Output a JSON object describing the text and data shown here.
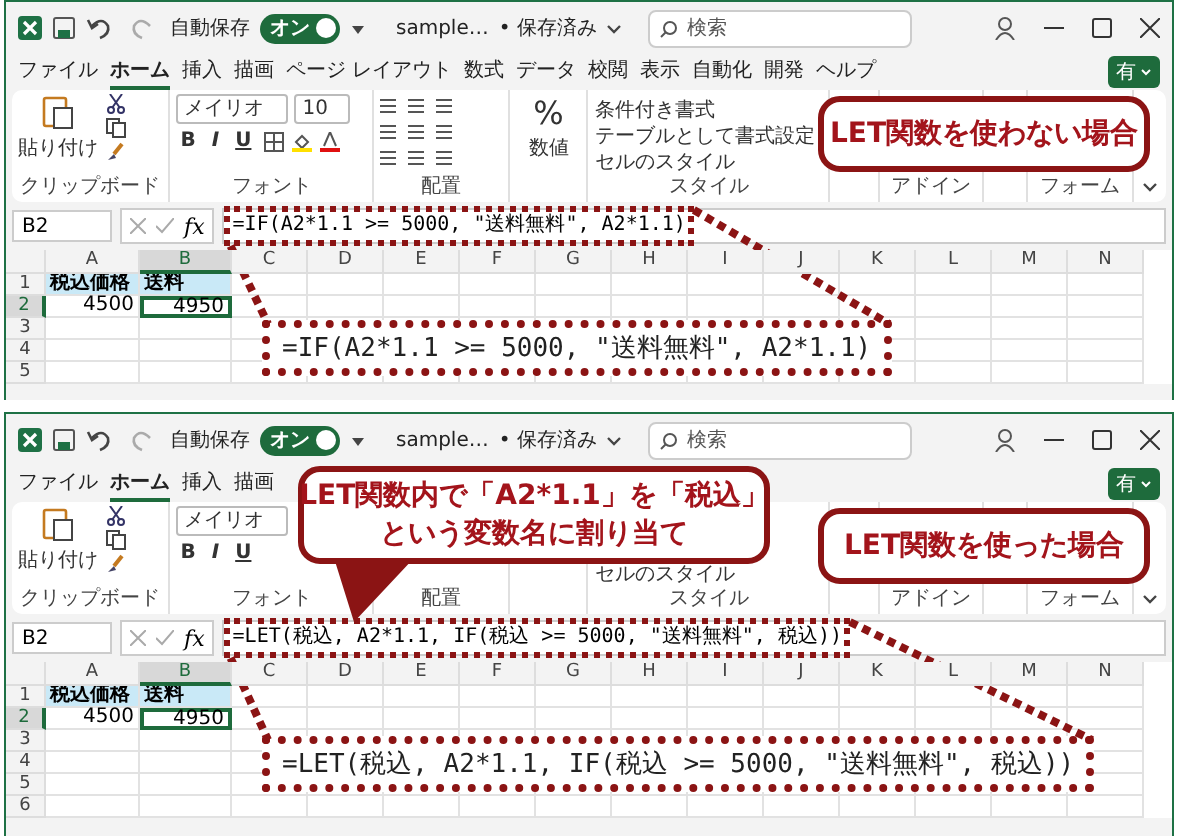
{
  "panels": [
    {
      "title_bar": {
        "autosave_label": "自動保存",
        "autosave_toggle": {
          "label": "オン",
          "on": true
        },
        "file_name": "sample…",
        "save_status": "• 保存済み",
        "search_placeholder": "検索"
      },
      "tabs": [
        {
          "label": "ファイル",
          "selected": false
        },
        {
          "label": "ホーム",
          "selected": true
        },
        {
          "label": "挿入",
          "selected": false
        },
        {
          "label": "描画",
          "selected": false
        },
        {
          "label": "ページ レイアウト",
          "selected": false
        },
        {
          "label": "数式",
          "selected": false
        },
        {
          "label": "データ",
          "selected": false
        },
        {
          "label": "校閲",
          "selected": false
        },
        {
          "label": "表示",
          "selected": false
        },
        {
          "label": "自動化",
          "selected": false
        },
        {
          "label": "開発",
          "selected": false
        },
        {
          "label": "ヘルプ",
          "selected": false
        }
      ],
      "share_button": "有",
      "ribbon": {
        "format_icons": true,
        "paste": "貼り付け",
        "clipboard": "クリップボード",
        "font_name": "メイリオ",
        "font_size": "10",
        "font_buttons": [
          "B",
          "I",
          "U"
        ],
        "font": "フォント",
        "alignment": "配置",
        "number_symbol": "%",
        "number_format": "数値",
        "style_items": [
          "条件付き書式",
          "テーブルとして書式設定",
          "セルのスタイル"
        ],
        "style": "スタイル",
        "addin": "アドイン",
        "form": "フォーム"
      },
      "formula_bar": {
        "name_box": "B2",
        "fx": "fx",
        "formula": "=IF(A2*1.1 >= 5000, \"送料無料\", A2*1.1)"
      },
      "columns": [
        {
          "label": "A",
          "selected": false
        },
        {
          "label": "B",
          "selected": true
        },
        {
          "label": "C",
          "selected": false
        },
        {
          "label": "D",
          "selected": false
        },
        {
          "label": "E",
          "selected": false
        },
        {
          "label": "F",
          "selected": false
        },
        {
          "label": "G",
          "selected": false
        },
        {
          "label": "H",
          "selected": false
        },
        {
          "label": "I",
          "selected": false
        },
        {
          "label": "J",
          "selected": false
        },
        {
          "label": "K",
          "selected": false
        },
        {
          "label": "L",
          "selected": false
        },
        {
          "label": "M",
          "selected": false
        },
        {
          "label": "N",
          "selected": false
        }
      ],
      "rows": [
        {
          "label": "1",
          "selected": false,
          "cells": [
            {
              "value": "税込価格",
              "kind": "header",
              "selected": false
            },
            {
              "value": "送料",
              "kind": "header",
              "selected": false
            }
          ]
        },
        {
          "label": "2",
          "selected": true,
          "cells": [
            {
              "value": "4500",
              "kind": "number",
              "selected": false
            },
            {
              "value": "4950",
              "kind": "number",
              "selected": true
            }
          ]
        },
        {
          "label": "3",
          "selected": false
        },
        {
          "label": "4",
          "selected": false
        },
        {
          "label": "5",
          "selected": false
        }
      ],
      "formula_zoom": "=IF(A2*1.1 >= 5000, \"送料無料\", A2*1.1)",
      "callouts": [
        {
          "lines": [
            "LET関数を使わない場合"
          ],
          "pointer": false
        }
      ]
    },
    {
      "title_bar": {
        "autosave_label": "自動保存",
        "autosave_toggle": {
          "label": "オン",
          "on": true
        },
        "file_name": "sample…",
        "save_status": "• 保存済み",
        "search_placeholder": "検索"
      },
      "tabs": [
        {
          "label": "ファイル",
          "selected": false
        },
        {
          "label": "ホーム",
          "selected": true
        },
        {
          "label": "挿入",
          "selected": false
        },
        {
          "label": "描画",
          "selected": false
        }
      ],
      "share_button": "有",
      "ribbon": {
        "paste": "貼り付け",
        "clipboard": "クリップボード",
        "font_name": "メイリオ",
        "font_buttons": [
          "B",
          "I",
          "U"
        ],
        "font": "フォント",
        "alignment": "配置",
        "style_items": [
          "セルのスタイル"
        ],
        "style": "スタイル",
        "addin": "アドイン",
        "form": "フォーム"
      },
      "formula_bar": {
        "name_box": "B2",
        "fx": "fx",
        "formula": "=LET(税込, A2*1.1, IF(税込 >= 5000, \"送料無料\", 税込))"
      },
      "columns": [
        {
          "label": "A",
          "selected": false
        },
        {
          "label": "B",
          "selected": true
        },
        {
          "label": "C",
          "selected": false
        },
        {
          "label": "D",
          "selected": false
        },
        {
          "label": "E",
          "selected": false
        },
        {
          "label": "F",
          "selected": false
        },
        {
          "label": "G",
          "selected": false
        },
        {
          "label": "H",
          "selected": false
        },
        {
          "label": "I",
          "selected": false
        },
        {
          "label": "J",
          "selected": false
        },
        {
          "label": "K",
          "selected": false
        },
        {
          "label": "L",
          "selected": false
        },
        {
          "label": "M",
          "selected": false
        },
        {
          "label": "N",
          "selected": false
        }
      ],
      "rows": [
        {
          "label": "1",
          "selected": false,
          "cells": [
            {
              "value": "税込価格",
              "kind": "header",
              "selected": false
            },
            {
              "value": "送料",
              "kind": "header",
              "selected": false
            }
          ]
        },
        {
          "label": "2",
          "selected": true,
          "cells": [
            {
              "value": "4500",
              "kind": "number",
              "selected": false
            },
            {
              "value": "4950",
              "kind": "number",
              "selected": true
            }
          ]
        },
        {
          "label": "3",
          "selected": false
        },
        {
          "label": "4",
          "selected": false
        },
        {
          "label": "5",
          "selected": false
        },
        {
          "label": "6",
          "selected": false
        }
      ],
      "formula_zoom": "=LET(税込, A2*1.1, IF(税込 >= 5000, \"送料無料\", 税込))",
      "callouts": [
        {
          "lines": [
            "LET関数内で「A2*1.1」を「税込」",
            "という変数名に割り当て"
          ],
          "pointer": true
        },
        {
          "lines": [
            "LET関数を使った場合"
          ],
          "pointer": false
        }
      ]
    }
  ]
}
